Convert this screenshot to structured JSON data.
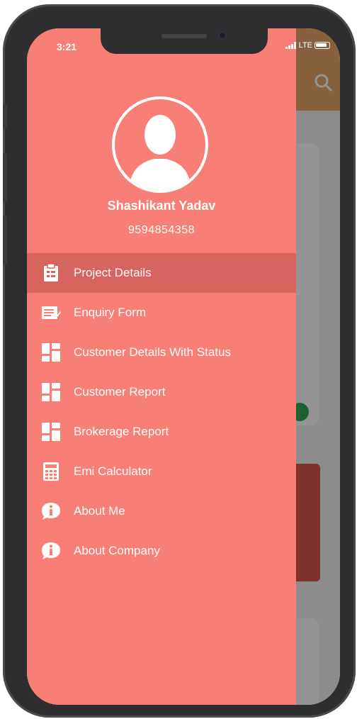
{
  "status_bar": {
    "time": "3:21",
    "network": "LTE"
  },
  "profile": {
    "name": "Shashikant Yadav",
    "phone": "9594854358"
  },
  "menu": {
    "items": [
      {
        "label": "Project Details",
        "icon": "clipboard-icon",
        "active": true
      },
      {
        "label": "Enquiry Form",
        "icon": "form-icon",
        "active": false
      },
      {
        "label": "Customer Details With Status",
        "icon": "dashboard-icon",
        "active": false
      },
      {
        "label": "Customer Report",
        "icon": "dashboard-icon",
        "active": false
      },
      {
        "label": "Brokerage Report",
        "icon": "dashboard-icon",
        "active": false
      },
      {
        "label": "Emi Calculator",
        "icon": "calculator-icon",
        "active": false
      },
      {
        "label": "About Me",
        "icon": "info-icon",
        "active": false
      },
      {
        "label": "About Company",
        "icon": "info-icon",
        "active": false
      }
    ]
  },
  "colors": {
    "drawer": "#f77f76",
    "active_item": "#d66560",
    "header": "#e8a86a",
    "text": "#ffffff"
  }
}
